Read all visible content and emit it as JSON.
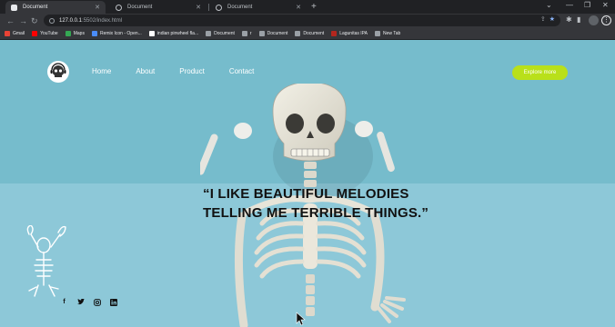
{
  "browser": {
    "tabs": [
      {
        "title": "Document",
        "active": true
      },
      {
        "title": "Document",
        "active": false
      },
      {
        "title": "Document",
        "active": false
      }
    ],
    "url_host": "127.0.0.1",
    "url_rest": ":5502/index.html",
    "bookmarks": [
      {
        "label": "Gmail",
        "icon": "gmail-icon",
        "color": "#ea4335"
      },
      {
        "label": "YouTube",
        "icon": "youtube-icon",
        "color": "#ff0000"
      },
      {
        "label": "Maps",
        "icon": "maps-icon",
        "color": "#34a853"
      },
      {
        "label": "Remix Icon - Open...",
        "icon": "remix-icon",
        "color": "#4a8cf7"
      },
      {
        "label": "indian pinwheel fla...",
        "icon": "google-icon",
        "color": "#ffffff"
      },
      {
        "label": "Document",
        "icon": "globe-icon",
        "color": "#9aa0a6"
      },
      {
        "label": "r",
        "icon": "globe-icon",
        "color": "#9aa0a6"
      },
      {
        "label": "Document",
        "icon": "globe-icon",
        "color": "#9aa0a6"
      },
      {
        "label": "Document",
        "icon": "globe-icon",
        "color": "#9aa0a6"
      },
      {
        "label": "Lagunitas IPA",
        "icon": "lagunitas-icon",
        "color": "#b3261e"
      },
      {
        "label": "New Tab",
        "icon": "globe-icon",
        "color": "#9aa0a6"
      }
    ]
  },
  "site": {
    "nav": [
      "Home",
      "About",
      "Product",
      "Contact"
    ],
    "cta": "Explore more",
    "quote": "“I LIKE BEAUTIFUL MELODIES\nTELLING ME TERRIBLE THINGS.”",
    "socials": [
      "facebook-icon",
      "twitter-icon",
      "instagram-icon",
      "linkedin-icon"
    ],
    "colors": {
      "accent": "#b9e01a",
      "bg_top": "#76bccc",
      "bg_bottom": "#8dc8d8"
    }
  }
}
